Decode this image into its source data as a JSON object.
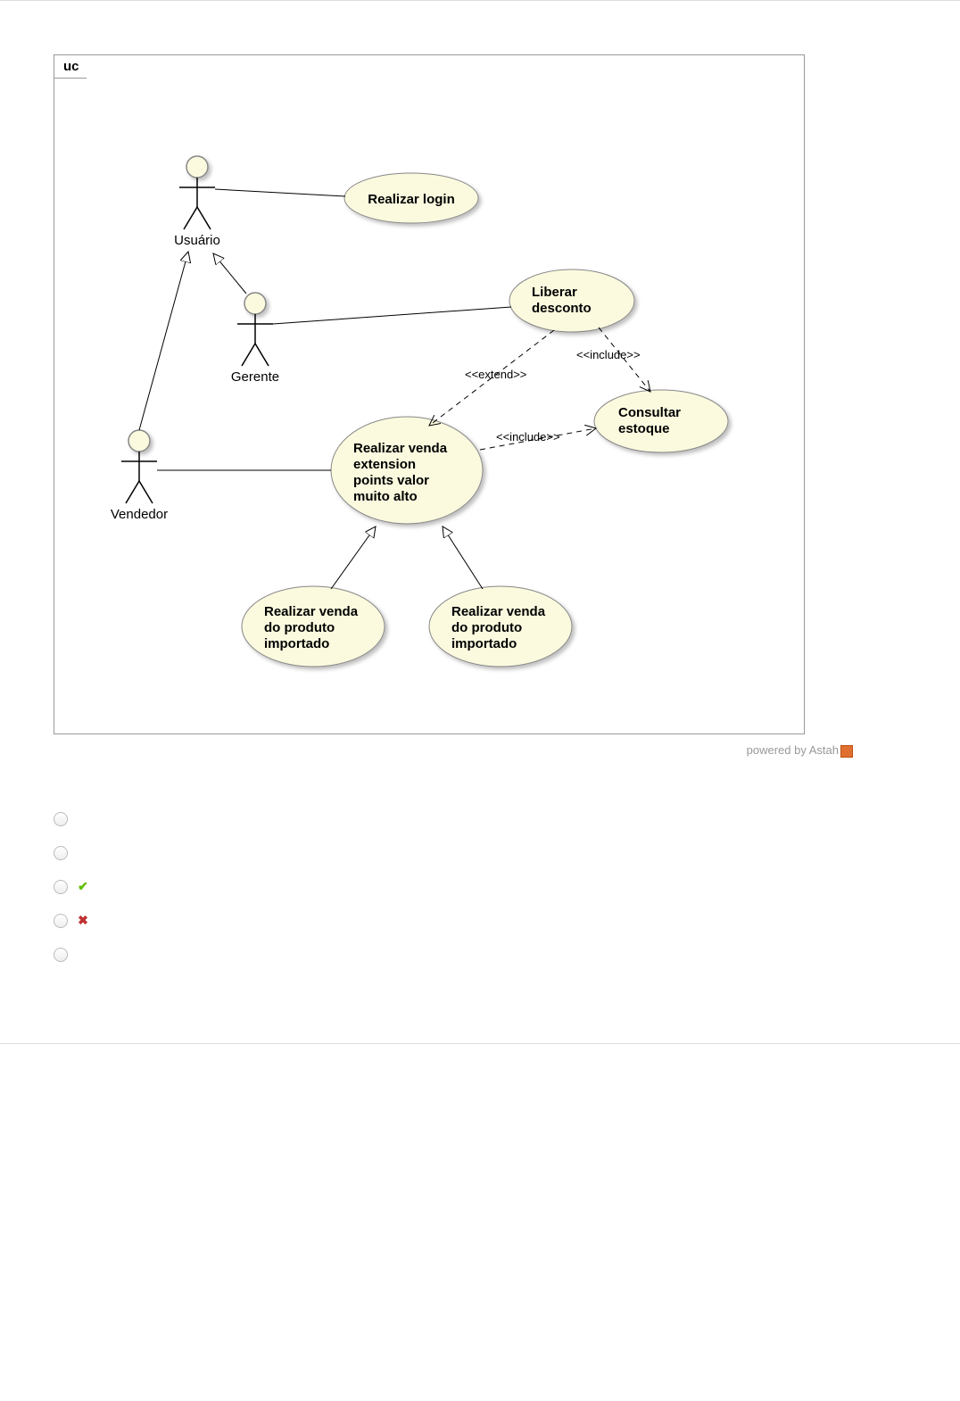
{
  "diagram": {
    "frame_label": "uc",
    "actors": {
      "usuario": "Usuário",
      "gerente": "Gerente",
      "vendedor": "Vendedor"
    },
    "usecases": {
      "realizar_login": "Realizar login",
      "liberar_desconto_l1": "Liberar",
      "liberar_desconto_l2": "desconto",
      "consultar_estoque_l1": "Consultar",
      "consultar_estoque_l2": "estoque",
      "realizar_venda_l1": "Realizar venda",
      "realizar_venda_l2": "extension",
      "realizar_venda_l3": "points valor",
      "realizar_venda_l4": "muito alto",
      "venda_importado_a_l1": "Realizar venda",
      "venda_importado_a_l2": "do produto",
      "venda_importado_a_l3": "importado",
      "venda_importado_b_l1": "Realizar venda",
      "venda_importado_b_l2": "do produto",
      "venda_importado_b_l3": "importado"
    },
    "stereotypes": {
      "extend": "<<extend>>",
      "include1": "<<include>>",
      "include2": "<<include>>"
    }
  },
  "credit": "powered by Astah",
  "options": [
    {
      "id": "opt-a",
      "correct": false,
      "wrong": false
    },
    {
      "id": "opt-b",
      "correct": false,
      "wrong": false
    },
    {
      "id": "opt-c",
      "correct": true,
      "wrong": false
    },
    {
      "id": "opt-d",
      "correct": false,
      "wrong": true
    },
    {
      "id": "opt-e",
      "correct": false,
      "wrong": false
    }
  ]
}
